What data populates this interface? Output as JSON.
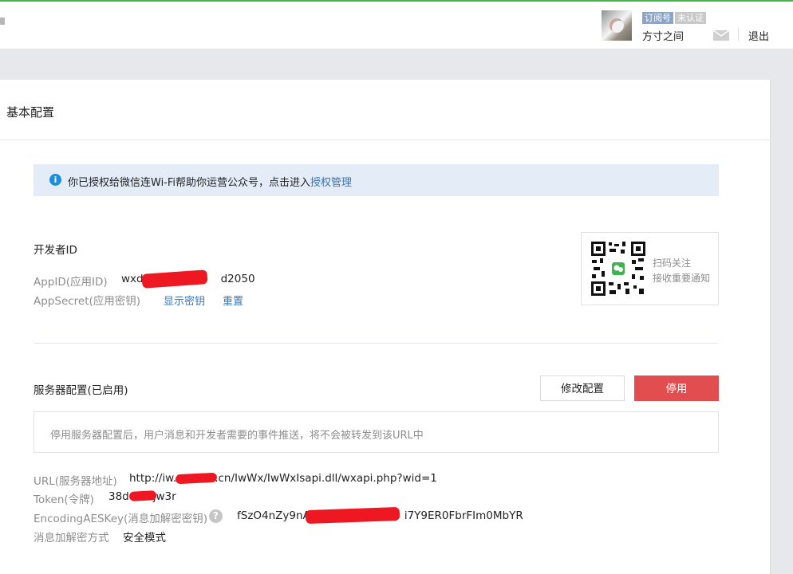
{
  "header": {
    "badge_subscription": "订阅号",
    "badge_unverified": "未认证",
    "account_name": "方寸之间",
    "logout": "退出"
  },
  "page": {
    "title": "基本配置"
  },
  "notice": {
    "text": "你已授权给微信连Wi-Fi帮助你运营公众号，点击进入",
    "link": "授权管理"
  },
  "developer": {
    "title": "开发者ID",
    "appid_label": "AppID(应用ID)",
    "appid_value_start": "wxd",
    "appid_value_end": "d2050",
    "appsecret_label": "AppSecret(应用密钥)",
    "show_secret": "显示密钥",
    "reset": "重置"
  },
  "qr": {
    "line1": "扫码关注",
    "line2": "接收重要通知"
  },
  "server": {
    "title": "服务器配置(已启用)",
    "edit_button": "修改配置",
    "stop_button": "停用",
    "notice": "停用服务器配置后，用户消息和开发者需要的事件推送，将不会被转发到该URL中",
    "url_label": "URL(服务器地址)",
    "url_start": "http://iw.",
    "url_end": ".cn/IwWx/IwWxIsapi.dll/wxapi.php?wid=1",
    "token_label": "Token(令牌)",
    "token_start": "38d",
    "token_end": "jw3r",
    "aes_label": "EncodingAESKey(消息加解密密钥)",
    "aes_start": "fSzO4nZy9nA",
    "aes_end": "i7Y9ER0FbrFIm0MbYR",
    "mode_label": "消息加解密方式",
    "mode_value": "安全模式"
  }
}
